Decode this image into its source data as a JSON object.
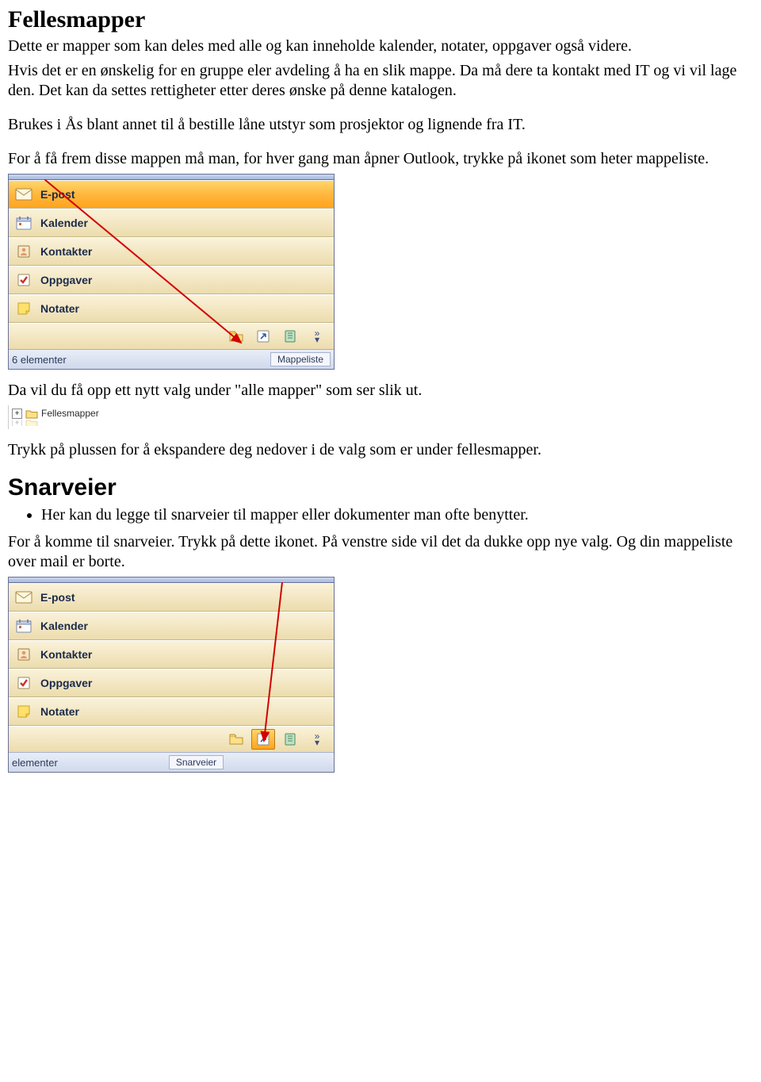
{
  "heading1": "Fellesmapper",
  "para1": "Dette er mapper som kan deles med alle og kan inneholde kalender, notater, oppgaver også videre.",
  "para2": "Hvis det er en ønskelig for en gruppe eler avdeling å ha en slik mappe. Da må dere ta kontakt med IT og vi vil lage den. Det kan da settes rettigheter etter deres ønske på denne katalogen.",
  "para3": "Brukes i Ås blant annet til å bestille låne utstyr som prosjektor og lignende fra IT.",
  "para4": "For å få frem disse mappen må man, for hver gang man åpner Outlook, trykke på ikonet som heter mappeliste.",
  "para5": "Da vil du få opp ett nytt valg under \"alle mapper\" som ser slik ut.",
  "tree_label": "Fellesmapper",
  "para6": "Trykk på plussen for å ekspandere deg nedover i de valg som er under fellesmapper.",
  "heading2": "Snarveier",
  "bullet1": "Her kan du legge til snarveier til mapper eller dokumenter man ofte benytter.",
  "para7": "For å komme til snarveier. Trykk på dette ikonet. På venstre side vil det da dukke opp nye valg. Og din mappeliste over mail er borte.",
  "nav": {
    "items": [
      {
        "label": "E-post"
      },
      {
        "label": "Kalender"
      },
      {
        "label": "Kontakter"
      },
      {
        "label": "Oppgaver"
      },
      {
        "label": "Notater"
      }
    ]
  },
  "status1_left": "6 elementer",
  "status1_right": "Mappeliste",
  "status2_left": "elementer",
  "status2_right": "Snarveier",
  "icons": {
    "mail": "mail-icon",
    "calendar": "calendar-icon",
    "contacts": "contacts-icon",
    "tasks": "tasks-icon",
    "notes": "notes-icon",
    "folder": "folder-icon",
    "shortcut": "shortcut-icon",
    "journal": "journal-icon"
  }
}
